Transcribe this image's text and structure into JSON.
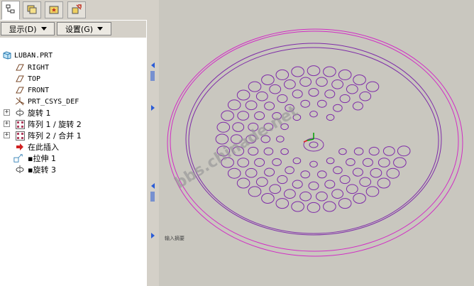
{
  "tabs": [
    {
      "icon": "model-tree-icon",
      "active": true
    },
    {
      "icon": "folder-browser-icon",
      "active": false
    },
    {
      "icon": "favorites-icon",
      "active": false
    },
    {
      "icon": "connections-icon",
      "active": false
    }
  ],
  "toolbar": {
    "show_label": "显示(D)",
    "settings_label": "设置(G)"
  },
  "tree": {
    "items": [
      {
        "label": "LUBAN.PRT",
        "icon": "part-icon"
      },
      {
        "label": "RIGHT",
        "icon": "datum-plane-icon"
      },
      {
        "label": "TOP",
        "icon": "datum-plane-icon"
      },
      {
        "label": "FRONT",
        "icon": "datum-plane-icon"
      },
      {
        "label": "PRT_CSYS_DEF",
        "icon": "coordinate-system-icon"
      },
      {
        "label": "旋转 1",
        "icon": "revolve-icon"
      },
      {
        "label": "阵列 1 / 旋转 2",
        "icon": "pattern-icon"
      },
      {
        "label": "阵列 2 / 合并 1",
        "icon": "pattern-icon"
      },
      {
        "label": "在此插入",
        "icon": "insert-here-arrow-icon"
      },
      {
        "label": "拉伸 1",
        "icon": "extrude-icon"
      },
      {
        "label": "旋转 3",
        "icon": "revolve-icon"
      }
    ]
  },
  "graphics": {
    "status_text": "输入摘要",
    "watermark": "bbs.chinade.net",
    "model_color": "#7e2ba8",
    "rim_color": "#d12cc4",
    "background_color": "#c9c7bf"
  }
}
